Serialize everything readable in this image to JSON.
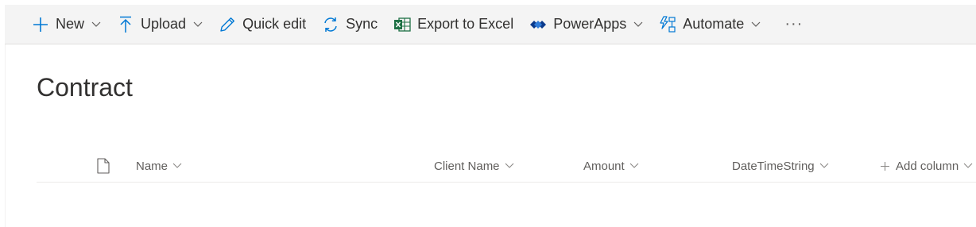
{
  "toolbar": {
    "new_label": "New",
    "upload_label": "Upload",
    "quick_edit_label": "Quick edit",
    "sync_label": "Sync",
    "export_label": "Export to Excel",
    "powerapps_label": "PowerApps",
    "automate_label": "Automate",
    "more_label": "···"
  },
  "page": {
    "title": "Contract"
  },
  "columns": {
    "name": "Name",
    "client_name": "Client Name",
    "amount": "Amount",
    "datetime": "DateTimeString",
    "add_column": "Add column"
  },
  "colors": {
    "accent": "#0078d4",
    "excel": "#1e7145",
    "text": "#323130",
    "muted": "#605e5c"
  }
}
